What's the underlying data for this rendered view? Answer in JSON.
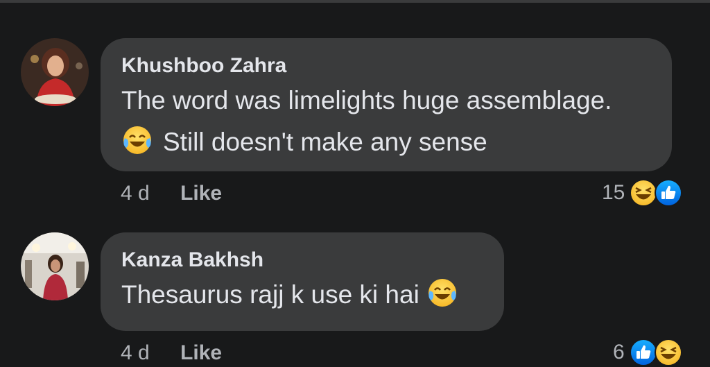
{
  "comments": [
    {
      "author": "Khushboo Zahra",
      "line1": "The word was limelights huge assemblage.",
      "line2": "Still doesn't make any sense",
      "time": "4 d",
      "like_label": "Like",
      "reaction_count": "15",
      "reaction_icons": [
        "laughing-reaction-icon",
        "thumbs-up-reaction-icon"
      ]
    },
    {
      "author": "Kanza Bakhsh",
      "line1": "Thesaurus rajj k use ki hai",
      "time": "4 d",
      "like_label": "Like",
      "reaction_count": "6",
      "reaction_icons": [
        "thumbs-up-reaction-icon",
        "laughing-reaction-icon"
      ]
    }
  ],
  "colors": {
    "background": "#18191a",
    "bubble": "#3a3b3c",
    "text": "#e4e6eb",
    "secondary_text": "#b0b3b8",
    "like_blue": "#1877f2",
    "haha_yellow": "#f7b928"
  }
}
